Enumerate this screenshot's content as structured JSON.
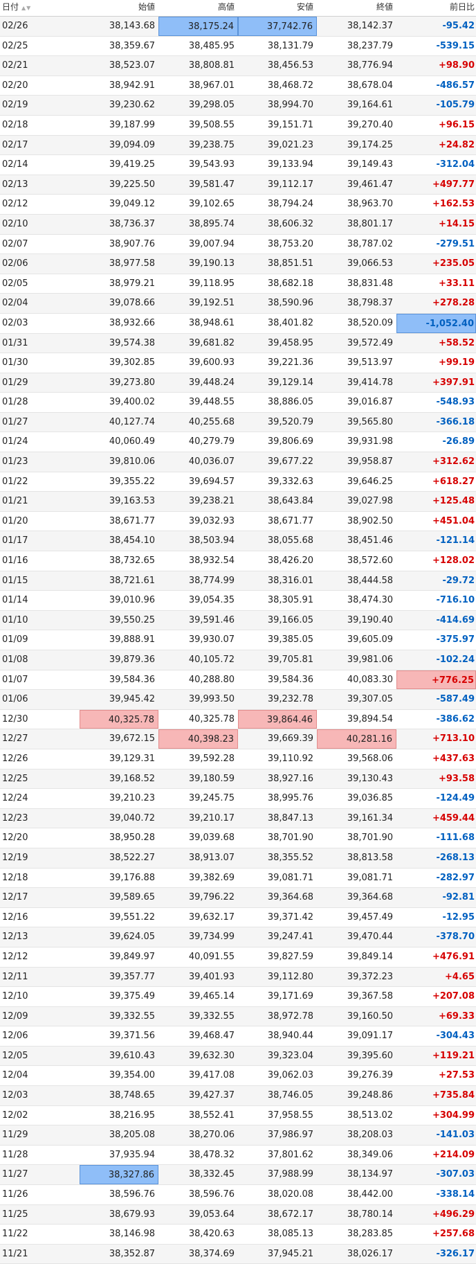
{
  "header": {
    "date": "日付",
    "open": "始値",
    "high": "高値",
    "low": "安値",
    "close": "終値",
    "change": "前日比"
  },
  "rows": [
    [
      "02/26",
      "38,143.68",
      "38,175.24",
      "37,742.76",
      "38,142.37",
      "-95.42"
    ],
    [
      "02/25",
      "38,359.67",
      "38,485.95",
      "38,131.79",
      "38,237.79",
      "-539.15"
    ],
    [
      "02/21",
      "38,523.07",
      "38,808.81",
      "38,456.53",
      "38,776.94",
      "+98.90"
    ],
    [
      "02/20",
      "38,942.91",
      "38,967.01",
      "38,468.72",
      "38,678.04",
      "-486.57"
    ],
    [
      "02/19",
      "39,230.62",
      "39,298.05",
      "38,994.70",
      "39,164.61",
      "-105.79"
    ],
    [
      "02/18",
      "39,187.99",
      "39,508.55",
      "39,151.71",
      "39,270.40",
      "+96.15"
    ],
    [
      "02/17",
      "39,094.09",
      "39,238.75",
      "39,021.23",
      "39,174.25",
      "+24.82"
    ],
    [
      "02/14",
      "39,419.25",
      "39,543.93",
      "39,133.94",
      "39,149.43",
      "-312.04"
    ],
    [
      "02/13",
      "39,225.50",
      "39,581.47",
      "39,112.17",
      "39,461.47",
      "+497.77"
    ],
    [
      "02/12",
      "39,049.12",
      "39,102.65",
      "38,794.24",
      "38,963.70",
      "+162.53"
    ],
    [
      "02/10",
      "38,736.37",
      "38,895.74",
      "38,606.32",
      "38,801.17",
      "+14.15"
    ],
    [
      "02/07",
      "38,907.76",
      "39,007.94",
      "38,753.20",
      "38,787.02",
      "-279.51"
    ],
    [
      "02/06",
      "38,977.58",
      "39,190.13",
      "38,851.51",
      "39,066.53",
      "+235.05"
    ],
    [
      "02/05",
      "38,979.21",
      "39,118.95",
      "38,682.18",
      "38,831.48",
      "+33.11"
    ],
    [
      "02/04",
      "39,078.66",
      "39,192.51",
      "38,590.96",
      "38,798.37",
      "+278.28"
    ],
    [
      "02/03",
      "38,932.66",
      "38,948.61",
      "38,401.82",
      "38,520.09",
      "-1,052.40"
    ],
    [
      "01/31",
      "39,574.38",
      "39,681.82",
      "39,458.95",
      "39,572.49",
      "+58.52"
    ],
    [
      "01/30",
      "39,302.85",
      "39,600.93",
      "39,221.36",
      "39,513.97",
      "+99.19"
    ],
    [
      "01/29",
      "39,273.80",
      "39,448.24",
      "39,129.14",
      "39,414.78",
      "+397.91"
    ],
    [
      "01/28",
      "39,400.02",
      "39,448.55",
      "38,886.05",
      "39,016.87",
      "-548.93"
    ],
    [
      "01/27",
      "40,127.74",
      "40,255.68",
      "39,520.79",
      "39,565.80",
      "-366.18"
    ],
    [
      "01/24",
      "40,060.49",
      "40,279.79",
      "39,806.69",
      "39,931.98",
      "-26.89"
    ],
    [
      "01/23",
      "39,810.06",
      "40,036.07",
      "39,677.22",
      "39,958.87",
      "+312.62"
    ],
    [
      "01/22",
      "39,355.22",
      "39,694.57",
      "39,332.63",
      "39,646.25",
      "+618.27"
    ],
    [
      "01/21",
      "39,163.53",
      "39,238.21",
      "38,643.84",
      "39,027.98",
      "+125.48"
    ],
    [
      "01/20",
      "38,671.77",
      "39,032.93",
      "38,671.77",
      "38,902.50",
      "+451.04"
    ],
    [
      "01/17",
      "38,454.10",
      "38,503.94",
      "38,055.68",
      "38,451.46",
      "-121.14"
    ],
    [
      "01/16",
      "38,732.65",
      "38,932.54",
      "38,426.20",
      "38,572.60",
      "+128.02"
    ],
    [
      "01/15",
      "38,721.61",
      "38,774.99",
      "38,316.01",
      "38,444.58",
      "-29.72"
    ],
    [
      "01/14",
      "39,010.96",
      "39,054.35",
      "38,305.91",
      "38,474.30",
      "-716.10"
    ],
    [
      "01/10",
      "39,550.25",
      "39,591.46",
      "39,166.05",
      "39,190.40",
      "-414.69"
    ],
    [
      "01/09",
      "39,888.91",
      "39,930.07",
      "39,385.05",
      "39,605.09",
      "-375.97"
    ],
    [
      "01/08",
      "39,879.36",
      "40,105.72",
      "39,705.81",
      "39,981.06",
      "-102.24"
    ],
    [
      "01/07",
      "39,584.36",
      "40,288.80",
      "39,584.36",
      "40,083.30",
      "+776.25"
    ],
    [
      "01/06",
      "39,945.42",
      "39,993.50",
      "39,232.78",
      "39,307.05",
      "-587.49"
    ],
    [
      "12/30",
      "40,325.78",
      "40,325.78",
      "39,864.46",
      "39,894.54",
      "-386.62"
    ],
    [
      "12/27",
      "39,672.15",
      "40,398.23",
      "39,669.39",
      "40,281.16",
      "+713.10"
    ],
    [
      "12/26",
      "39,129.31",
      "39,592.28",
      "39,110.92",
      "39,568.06",
      "+437.63"
    ],
    [
      "12/25",
      "39,168.52",
      "39,180.59",
      "38,927.16",
      "39,130.43",
      "+93.58"
    ],
    [
      "12/24",
      "39,210.23",
      "39,245.75",
      "38,995.76",
      "39,036.85",
      "-124.49"
    ],
    [
      "12/23",
      "39,040.72",
      "39,210.17",
      "38,847.13",
      "39,161.34",
      "+459.44"
    ],
    [
      "12/20",
      "38,950.28",
      "39,039.68",
      "38,701.90",
      "38,701.90",
      "-111.68"
    ],
    [
      "12/19",
      "38,522.27",
      "38,913.07",
      "38,355.52",
      "38,813.58",
      "-268.13"
    ],
    [
      "12/18",
      "39,176.88",
      "39,382.69",
      "39,081.71",
      "39,081.71",
      "-282.97"
    ],
    [
      "12/17",
      "39,589.65",
      "39,796.22",
      "39,364.68",
      "39,364.68",
      "-92.81"
    ],
    [
      "12/16",
      "39,551.22",
      "39,632.17",
      "39,371.42",
      "39,457.49",
      "-12.95"
    ],
    [
      "12/13",
      "39,624.05",
      "39,734.99",
      "39,247.41",
      "39,470.44",
      "-378.70"
    ],
    [
      "12/12",
      "39,849.97",
      "40,091.55",
      "39,827.59",
      "39,849.14",
      "+476.91"
    ],
    [
      "12/11",
      "39,357.77",
      "39,401.93",
      "39,112.80",
      "39,372.23",
      "+4.65"
    ],
    [
      "12/10",
      "39,375.49",
      "39,465.14",
      "39,171.69",
      "39,367.58",
      "+207.08"
    ],
    [
      "12/09",
      "39,332.55",
      "39,332.55",
      "38,972.78",
      "39,160.50",
      "+69.33"
    ],
    [
      "12/06",
      "39,371.56",
      "39,468.47",
      "38,940.44",
      "39,091.17",
      "-304.43"
    ],
    [
      "12/05",
      "39,610.43",
      "39,632.30",
      "39,323.04",
      "39,395.60",
      "+119.21"
    ],
    [
      "12/04",
      "39,354.00",
      "39,417.08",
      "39,062.03",
      "39,276.39",
      "+27.53"
    ],
    [
      "12/03",
      "38,748.65",
      "39,427.37",
      "38,746.05",
      "39,248.86",
      "+735.84"
    ],
    [
      "12/02",
      "38,216.95",
      "38,552.41",
      "37,958.55",
      "38,513.02",
      "+304.99"
    ],
    [
      "11/29",
      "38,205.08",
      "38,270.06",
      "37,986.97",
      "38,208.03",
      "-141.03"
    ],
    [
      "11/28",
      "37,935.94",
      "38,478.32",
      "37,801.62",
      "38,349.06",
      "+214.09"
    ],
    [
      "11/27",
      "38,327.86",
      "38,332.45",
      "37,988.99",
      "38,134.97",
      "-307.03"
    ],
    [
      "11/26",
      "38,596.76",
      "38,596.76",
      "38,020.08",
      "38,442.00",
      "-338.14"
    ],
    [
      "11/25",
      "38,679.93",
      "39,053.64",
      "38,672.17",
      "38,780.14",
      "+496.29"
    ],
    [
      "11/22",
      "38,146.98",
      "38,420.63",
      "38,085.13",
      "38,283.85",
      "+257.68"
    ],
    [
      "11/21",
      "38,352.87",
      "38,374.69",
      "37,945.21",
      "38,026.17",
      "-326.17"
    ]
  ],
  "highlights": [
    {
      "row": 0,
      "col": 2,
      "color": "blue"
    },
    {
      "row": 0,
      "col": 3,
      "color": "blue"
    },
    {
      "row": 15,
      "col": 5,
      "color": "blue"
    },
    {
      "row": 33,
      "col": 5,
      "color": "red"
    },
    {
      "row": 35,
      "col": 1,
      "color": "red"
    },
    {
      "row": 35,
      "col": 3,
      "color": "red"
    },
    {
      "row": 36,
      "col": 2,
      "color": "red"
    },
    {
      "row": 36,
      "col": 4,
      "color": "red"
    },
    {
      "row": 58,
      "col": 1,
      "color": "blue"
    },
    {
      "row": 63,
      "col": 4,
      "color": "blue"
    }
  ]
}
